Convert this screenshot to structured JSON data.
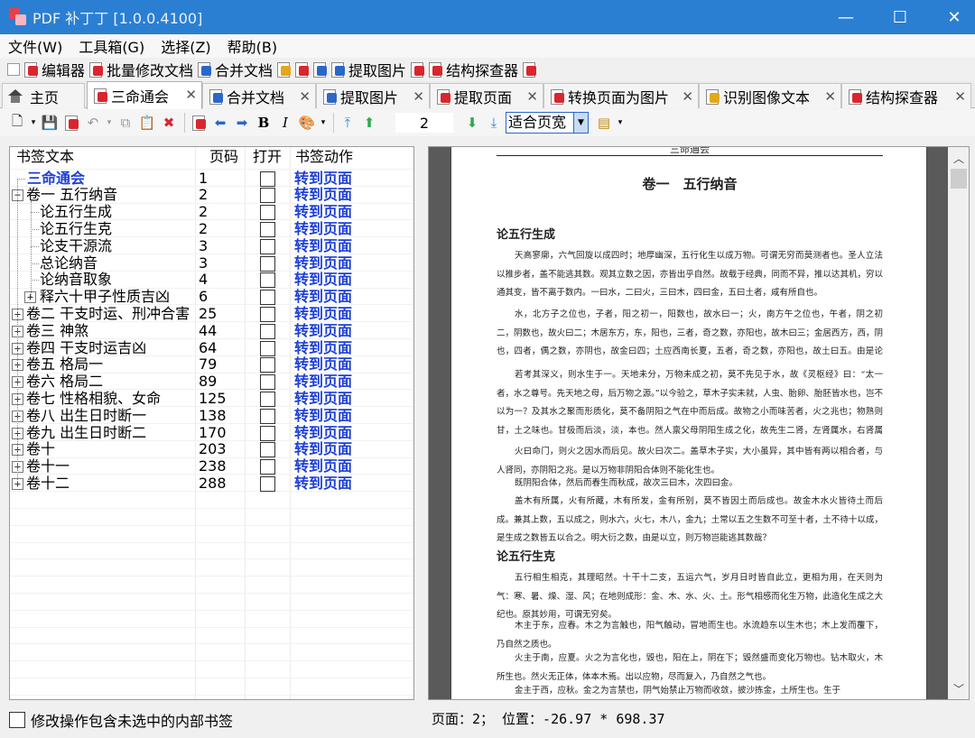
{
  "window": {
    "title": "PDF 补丁丁 [1.0.0.4100]",
    "minimize": "—",
    "maximize": "☐",
    "close": "✕"
  },
  "menu": [
    "文件(W)",
    "工具箱(G)",
    "选择(Z)",
    "帮助(B)"
  ],
  "quickbar": [
    "编辑器",
    "批量修改文档",
    "合并文档",
    "提取图片",
    "结构探查器"
  ],
  "tabs": [
    {
      "label": "主页"
    },
    {
      "label": "三命通会",
      "active": true
    },
    {
      "label": "合并文档"
    },
    {
      "label": "提取图片"
    },
    {
      "label": "提取页面"
    },
    {
      "label": "转换页面为图片"
    },
    {
      "label": "识别图像文本"
    },
    {
      "label": "结构探查器"
    }
  ],
  "toolbar": {
    "page_number": "2",
    "zoom_mode": "适合页宽"
  },
  "bookmarks": {
    "headers": {
      "text": "书签文本",
      "page": "页码",
      "open": "打开",
      "action": "书签动作"
    },
    "rows": [
      {
        "title": "三命通会",
        "page": "1",
        "action": "转到页面",
        "level": 0,
        "expander": ""
      },
      {
        "title": "卷一 五行纳音",
        "page": "2",
        "action": "转到页面",
        "level": 1,
        "expander": "−"
      },
      {
        "title": "论五行生成",
        "page": "2",
        "action": "转到页面",
        "level": 2,
        "expander": ""
      },
      {
        "title": "论五行生克",
        "page": "2",
        "action": "转到页面",
        "level": 2,
        "expander": ""
      },
      {
        "title": "论支干源流",
        "page": "3",
        "action": "转到页面",
        "level": 2,
        "expander": ""
      },
      {
        "title": "总论纳音",
        "page": "3",
        "action": "转到页面",
        "level": 2,
        "expander": ""
      },
      {
        "title": "论纳音取象",
        "page": "4",
        "action": "转到页面",
        "level": 2,
        "expander": ""
      },
      {
        "title": "释六十甲子性质吉凶",
        "page": "6",
        "action": "转到页面",
        "level": 2,
        "expander": "+"
      },
      {
        "title": "卷二 干支时运、刑冲合害",
        "page": "25",
        "action": "转到页面",
        "level": 1,
        "expander": "+"
      },
      {
        "title": "卷三 神煞",
        "page": "44",
        "action": "转到页面",
        "level": 1,
        "expander": "+"
      },
      {
        "title": "卷四 干支时运吉凶",
        "page": "64",
        "action": "转到页面",
        "level": 1,
        "expander": "+"
      },
      {
        "title": "卷五 格局一",
        "page": "79",
        "action": "转到页面",
        "level": 1,
        "expander": "+"
      },
      {
        "title": "卷六 格局二",
        "page": "89",
        "action": "转到页面",
        "level": 1,
        "expander": "+"
      },
      {
        "title": "卷七 性格相貌、女命",
        "page": "125",
        "action": "转到页面",
        "level": 1,
        "expander": "+"
      },
      {
        "title": "卷八 出生日时断一",
        "page": "138",
        "action": "转到页面",
        "level": 1,
        "expander": "+"
      },
      {
        "title": "卷九 出生日时断二",
        "page": "170",
        "action": "转到页面",
        "level": 1,
        "expander": "+"
      },
      {
        "title": "卷十",
        "page": "203",
        "action": "转到页面",
        "level": 1,
        "expander": "+"
      },
      {
        "title": "卷十一",
        "page": "238",
        "action": "转到页面",
        "level": 1,
        "expander": "+"
      },
      {
        "title": "卷十二",
        "page": "288",
        "action": "转到页面",
        "level": 1,
        "expander": "+"
      }
    ]
  },
  "bottom_option": "修改操作包含未选中的内部书签",
  "preview": {
    "running_header": "三命通会",
    "heading": "卷一　五行纳音",
    "section1": "论五行生成",
    "para1": "天高寥廓，六气回旋以成四时；地厚幽深，五行化生以成万物。可谓无穷而莫测者也。圣人立法以推步者，盖不能逃其数。观其立数之因，亦皆出乎自然。故载于经典，同而不异，推以达其机，穷以通其变，皆不离于数内。一曰水，二曰火，三曰木，四曰金，五曰土者，咸有所自也。",
    "para2": "水，北方子之位也，子者，阳之初一，阳数也，故水曰一；火，南方午之位也，午者，阴之初二，阴数也，故火曰二；木居东方，东，阳也，三者，奇之数，亦阳也，故木曰三；金居西方，西，阴也，四者，偶之数，亦阴也，故金曰四；土应西南长夏，五者，奇之数，亦阳也，故土曰五。由是论之，则数以阴阳而配者也。",
    "para3": "若考其深义，则水生于一。天地未分，万物未成之初，莫不先见于水，故《灵枢经》曰：“太一者，水之尊号。先天地之母，后万物之源。”以今验之，草木子实未就，人虫、胎卵、胎胚皆水也，岂不以为一？及其水之聚而形质化，莫不备阴阳之气在中而后成。故物之小而味苦者，火之兆也；物熟则甘，土之味也。甘极而后淡，淡，本也。然人禀父母阴阳生成之化，故先生二肾，左肾属水，右肾属火。",
    "para4": "火曰命门，则火之因水而后见。故火曰次二。盖草木子实，大小虽异，其中皆有两以相合者，与人肾同，亦阴阳之兆。是以万物非阴阳合体则不能化生也。",
    "para5": "既阴阳合体，然后而春生而秋成，故次三曰木，次四曰金。",
    "para6": "盖木有所属，火有所藏，木有所发，金有所别，莫不皆因土而后成也。故金木水火皆待土而后成。兼其上数，五以成之，则水六，火七，木八，金九；土常以五之生数不可至十者，土不待十以成，是生成之数皆五以合之。明大衍之数，由是以立，则万物岂能逃其数哉？",
    "section2": "论五行生克",
    "para7": "五行相生相克，其理昭然。十干十二支，五运六气，岁月日时皆自此立，更相为用，在天则为气：寒、暑、燥、湿、风；在地则成形：金、木、水、火、土。形气相感而化生万物，此造化生成之大纪也。原其妙用，可谓无穷矣。",
    "para8": "木主于东，应春。木之为言触也，阳气触动，冒地而生也。水流趋东以生木也；木上发而覆下，乃自然之质也。",
    "para9": "火主于南，应夏。火之为言化也，毁也，阳在上，阴在下；毁然盛而变化万物也。钻木取火，木所生也。然火无正体，体本木焉。出以应物，尽而复入，乃自然之气也。",
    "para10": "金主于西，应秋。金之为言禁也，阴气始禁止万物而收敛，披沙拣金，土所生也。生于"
  },
  "status": "页面：2； 位置：-26.97 * 698.37"
}
